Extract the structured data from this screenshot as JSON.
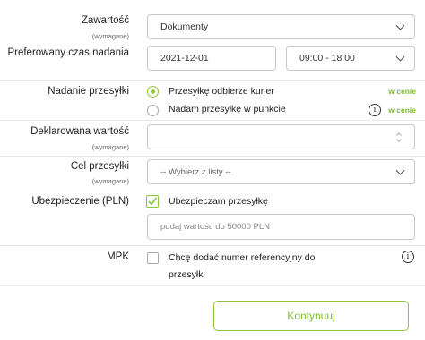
{
  "zawartosc": {
    "label": "Zawartość",
    "required": "(wymagane)",
    "value": "Dokumenty"
  },
  "pickup_time": {
    "label": "Preferowany czas nadania",
    "date": "2021-12-01",
    "time_range": "09:00 - 18:00"
  },
  "shipping": {
    "label": "Nadanie przesyłki",
    "options": [
      {
        "label": "Przesyłkę odbierze kurier",
        "price": "w cenie",
        "selected": true
      },
      {
        "label": "Nadam przesyłkę w punkcie",
        "price": "w cenie",
        "selected": false
      }
    ],
    "info_glyph": "i"
  },
  "declared_value": {
    "label": "Deklarowana wartość",
    "required": "(wymagane)",
    "value": ""
  },
  "purpose": {
    "label": "Cel przesyłki",
    "required": "(wymagane)",
    "placeholder": "-- Wybierz z listy --"
  },
  "insurance": {
    "label": "Ubezpieczenie (PLN)",
    "checkbox_label": "Ubezpieczam przesyłkę",
    "checked": true,
    "amount_placeholder": "podaj wartość do 50000 PLN"
  },
  "mpk": {
    "label": "MPK",
    "checkbox_label_line1": "Chcę dodać numer referencyjny do",
    "checkbox_label_line2": "przesyłki",
    "checked": false,
    "info_glyph": "i"
  },
  "actions": {
    "continue_label": "Kontynuuj"
  },
  "colors": {
    "accent": "#8cc63f",
    "accent_text": "#7cbb2c",
    "border": "#c8c8c8"
  }
}
